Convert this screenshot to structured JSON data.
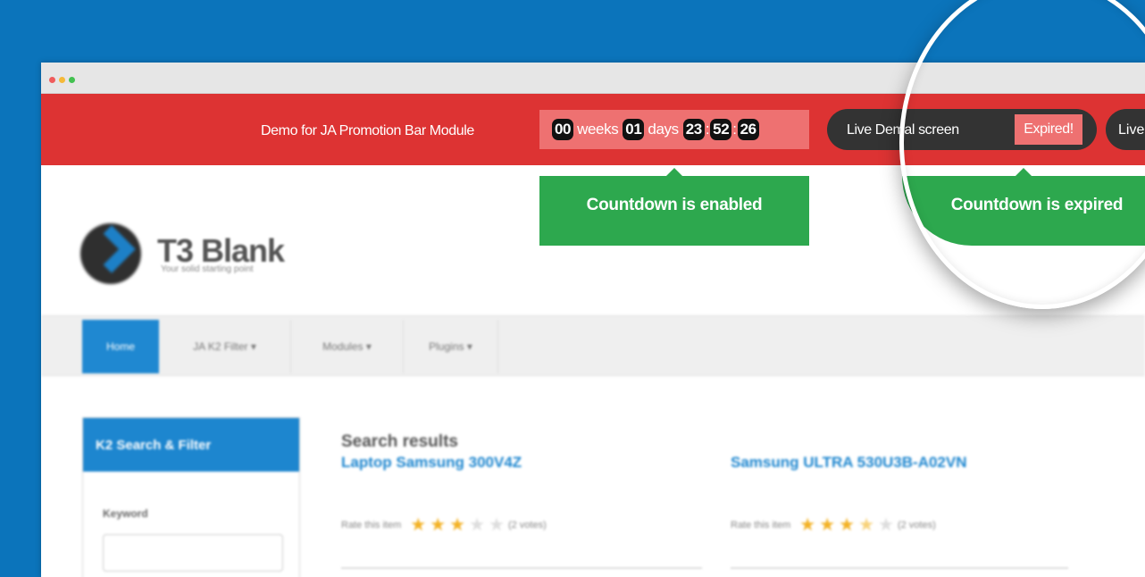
{
  "promo": {
    "text": "Demo for JA Promotion Bar Module",
    "countdown": {
      "weeks": "00",
      "weeks_label": "weeks",
      "days": "01",
      "days_label": "days",
      "hours": "23",
      "minutes": "52",
      "seconds": "26",
      "separator": ":"
    },
    "live_label": "Live Demal screen",
    "expired_label": "Expired!",
    "live_label_2": "Live"
  },
  "tooltips": {
    "enabled": "Countdown is enabled",
    "expired": "Countdown is expired"
  },
  "site": {
    "logo_title": "T3 Blank",
    "logo_subtitle": "Your solid starting point"
  },
  "nav": {
    "items": [
      {
        "label": "Home"
      },
      {
        "label": "JA K2 Filter ▾"
      },
      {
        "label": "Modules ▾"
      },
      {
        "label": "Plugins ▾"
      }
    ]
  },
  "sidebar": {
    "title": "K2 Search & Filter",
    "keyword_label": "Keyword"
  },
  "results": {
    "title": "Search results",
    "items": [
      {
        "title": "Laptop Samsung 300V4Z",
        "rate_text": "Rate this item",
        "votes": "(2 votes)",
        "rating": 3
      },
      {
        "title": "Samsung ULTRA 530U3B-A02VN",
        "rate_text": "Rate this item",
        "votes": "(2 votes)",
        "rating": 3.5
      }
    ]
  },
  "colors": {
    "background": "#0b74bb",
    "promo_bar": "#dd3333",
    "countdown_bg": "#ee7171",
    "tooltip_green": "#2da84e",
    "pill_dark": "#333333",
    "accent_blue": "#1d86cf"
  }
}
